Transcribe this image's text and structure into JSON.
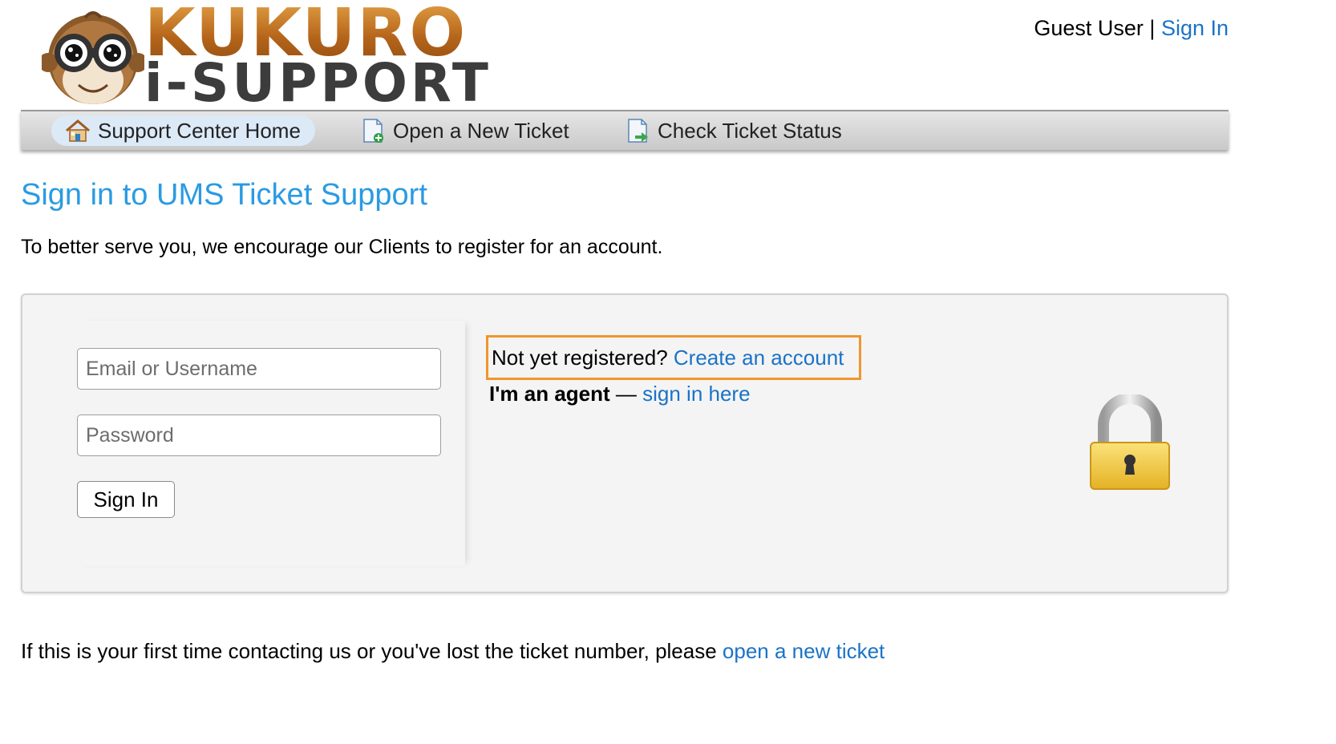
{
  "logo": {
    "line1": "KUKURO",
    "line2": "i-SUPPORT",
    "icon": "monkey-goggles-icon",
    "colors": {
      "brand_orange": "#c7781f",
      "brand_dark": "#3c3c3c"
    }
  },
  "user_area": {
    "guest_label": "Guest User",
    "separator": "|",
    "sign_in_link": "Sign In"
  },
  "nav": {
    "items": [
      {
        "label": "Support Center Home",
        "icon": "home-icon",
        "active": true
      },
      {
        "label": "Open a New Ticket",
        "icon": "new-ticket-icon",
        "active": false
      },
      {
        "label": "Check Ticket Status",
        "icon": "ticket-status-icon",
        "active": false
      }
    ]
  },
  "page": {
    "title": "Sign in to UMS Ticket Support",
    "intro": "To better serve you, we encourage our Clients to register for an account."
  },
  "login": {
    "email_placeholder": "Email or Username",
    "email_value": "",
    "password_placeholder": "Password",
    "password_value": "",
    "submit_label": "Sign In",
    "register_prompt": "Not yet registered?",
    "register_link": "Create an account",
    "agent_label": "I'm an agent",
    "agent_dash": "—",
    "agent_link": "sign in here",
    "lock_icon": "padlock-icon",
    "highlight_color": "#f0962e"
  },
  "footer": {
    "text": "If this is your first time contacting us or you've lost the ticket number, please",
    "link": "open a new ticket"
  },
  "colors": {
    "link": "#1a73c7",
    "title": "#2a9be2",
    "panel_bg": "#f4f4f4"
  }
}
